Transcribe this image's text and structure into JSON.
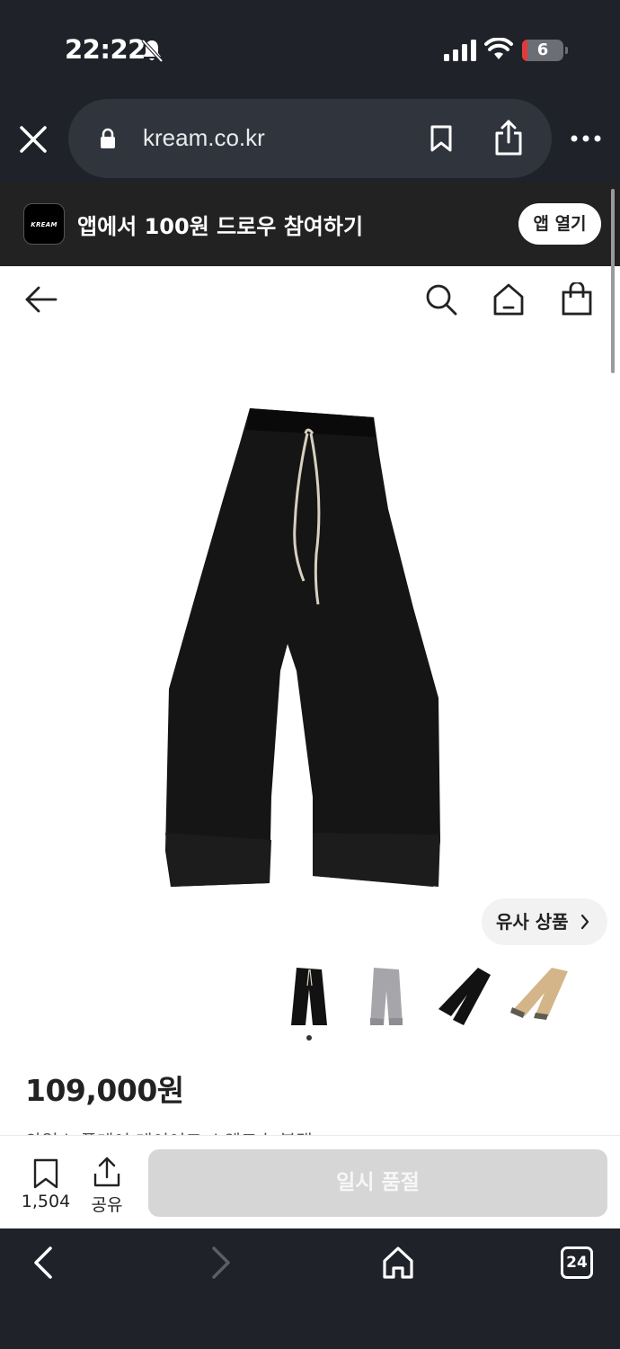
{
  "status_bar": {
    "time": "22:22",
    "battery_level": "6"
  },
  "browser": {
    "url": "kream.co.kr",
    "tab_count": "24"
  },
  "promo_banner": {
    "logo_text": "KREAM",
    "text": "앱에서 100원 드로우 참여하기",
    "open_app_label": "앱 열기"
  },
  "product": {
    "similar_label": "유사 상품",
    "price": "109,000원",
    "name_partial": "와일스 플레어 레이어드 스웨트츠 블랙",
    "thumbnails": [
      "black-pants",
      "grey-pants",
      "black-pants-flat",
      "beige-pants"
    ],
    "selected_thumbnail": 0
  },
  "action_bar": {
    "wish_count": "1,504",
    "share_label": "공유",
    "buy_button_label": "일시 품절"
  },
  "colors": {
    "browser_chrome": "#1f2229",
    "url_pill": "#30343d",
    "soldout_button": "#d6d6d6",
    "price_text": "#222222"
  }
}
